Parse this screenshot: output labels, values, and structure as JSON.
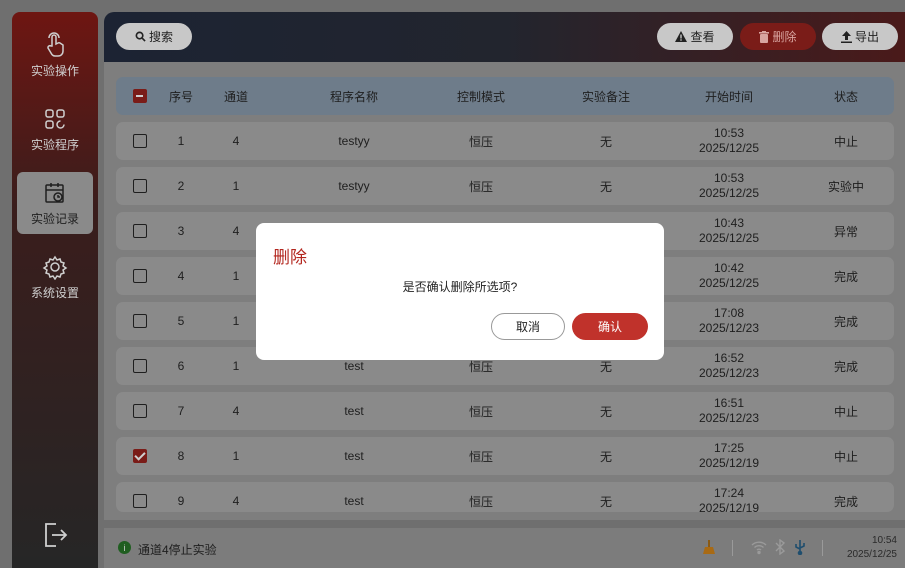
{
  "sidebar": {
    "items": [
      {
        "label": "实验操作",
        "icon": "hand-pointer-icon"
      },
      {
        "label": "实验程序",
        "icon": "grid-icon"
      },
      {
        "label": "实验记录",
        "icon": "calendar-clock-icon"
      },
      {
        "label": "系统设置",
        "icon": "gear-icon"
      }
    ],
    "exit_icon": "exit-icon"
  },
  "toolbar": {
    "search_label": "搜索",
    "view_label": "查看",
    "delete_label": "删除",
    "export_label": "导出"
  },
  "table": {
    "headers": [
      "序号",
      "通道",
      "程序名称",
      "控制模式",
      "实验备注",
      "开始时间",
      "状态"
    ],
    "rows": [
      {
        "checked": false,
        "no": "1",
        "channel": "4",
        "program": "testyy",
        "mode": "恒压",
        "note": "无",
        "time": "10:53",
        "date": "2025/12/25",
        "status": "中止"
      },
      {
        "checked": false,
        "no": "2",
        "channel": "1",
        "program": "testyy",
        "mode": "恒压",
        "note": "无",
        "time": "10:53",
        "date": "2025/12/25",
        "status": "实验中"
      },
      {
        "checked": false,
        "no": "3",
        "channel": "4",
        "program": "",
        "mode": "",
        "note": "",
        "time": "10:43",
        "date": "2025/12/25",
        "status": "异常"
      },
      {
        "checked": false,
        "no": "4",
        "channel": "1",
        "program": "",
        "mode": "",
        "note": "",
        "time": "10:42",
        "date": "2025/12/25",
        "status": "完成"
      },
      {
        "checked": false,
        "no": "5",
        "channel": "1",
        "program": "",
        "mode": "",
        "note": "",
        "time": "17:08",
        "date": "2025/12/23",
        "status": "完成"
      },
      {
        "checked": false,
        "no": "6",
        "channel": "1",
        "program": "test",
        "mode": "恒压",
        "note": "无",
        "time": "16:52",
        "date": "2025/12/23",
        "status": "完成"
      },
      {
        "checked": false,
        "no": "7",
        "channel": "4",
        "program": "test",
        "mode": "恒压",
        "note": "无",
        "time": "16:51",
        "date": "2025/12/23",
        "status": "中止"
      },
      {
        "checked": true,
        "no": "8",
        "channel": "1",
        "program": "test",
        "mode": "恒压",
        "note": "无",
        "time": "17:25",
        "date": "2025/12/19",
        "status": "中止"
      },
      {
        "checked": false,
        "no": "9",
        "channel": "4",
        "program": "test",
        "mode": "恒压",
        "note": "无",
        "time": "17:24",
        "date": "2025/12/19",
        "status": "完成"
      }
    ]
  },
  "status_bar": {
    "message": "通道4停止实验",
    "time": "10:54",
    "date": "2025/12/25"
  },
  "modal": {
    "title": "删除",
    "message": "是否确认删除所选项?",
    "cancel_label": "取消",
    "confirm_label": "确认"
  },
  "colors": {
    "accent": "#c0322b",
    "title_red": "#b3261e"
  }
}
